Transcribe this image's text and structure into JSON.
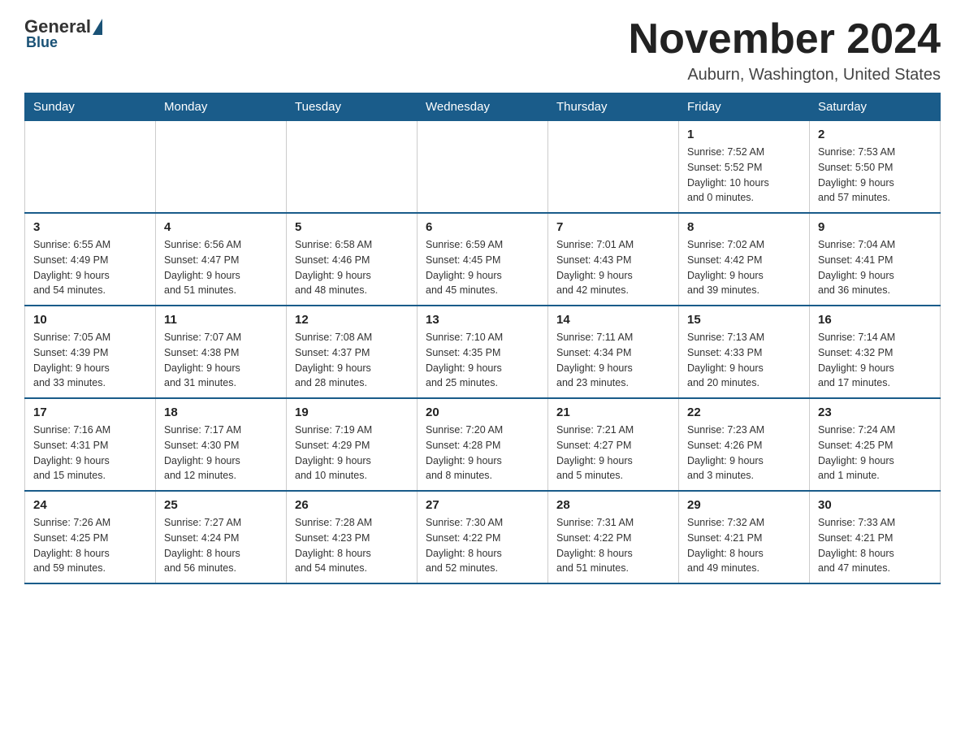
{
  "logo": {
    "general": "General",
    "blue": "Blue",
    "subtitle": "Blue"
  },
  "header": {
    "month_title": "November 2024",
    "location": "Auburn, Washington, United States"
  },
  "weekdays": [
    "Sunday",
    "Monday",
    "Tuesday",
    "Wednesday",
    "Thursday",
    "Friday",
    "Saturday"
  ],
  "weeks": [
    [
      {
        "day": "",
        "info": ""
      },
      {
        "day": "",
        "info": ""
      },
      {
        "day": "",
        "info": ""
      },
      {
        "day": "",
        "info": ""
      },
      {
        "day": "",
        "info": ""
      },
      {
        "day": "1",
        "info": "Sunrise: 7:52 AM\nSunset: 5:52 PM\nDaylight: 10 hours\nand 0 minutes."
      },
      {
        "day": "2",
        "info": "Sunrise: 7:53 AM\nSunset: 5:50 PM\nDaylight: 9 hours\nand 57 minutes."
      }
    ],
    [
      {
        "day": "3",
        "info": "Sunrise: 6:55 AM\nSunset: 4:49 PM\nDaylight: 9 hours\nand 54 minutes."
      },
      {
        "day": "4",
        "info": "Sunrise: 6:56 AM\nSunset: 4:47 PM\nDaylight: 9 hours\nand 51 minutes."
      },
      {
        "day": "5",
        "info": "Sunrise: 6:58 AM\nSunset: 4:46 PM\nDaylight: 9 hours\nand 48 minutes."
      },
      {
        "day": "6",
        "info": "Sunrise: 6:59 AM\nSunset: 4:45 PM\nDaylight: 9 hours\nand 45 minutes."
      },
      {
        "day": "7",
        "info": "Sunrise: 7:01 AM\nSunset: 4:43 PM\nDaylight: 9 hours\nand 42 minutes."
      },
      {
        "day": "8",
        "info": "Sunrise: 7:02 AM\nSunset: 4:42 PM\nDaylight: 9 hours\nand 39 minutes."
      },
      {
        "day": "9",
        "info": "Sunrise: 7:04 AM\nSunset: 4:41 PM\nDaylight: 9 hours\nand 36 minutes."
      }
    ],
    [
      {
        "day": "10",
        "info": "Sunrise: 7:05 AM\nSunset: 4:39 PM\nDaylight: 9 hours\nand 33 minutes."
      },
      {
        "day": "11",
        "info": "Sunrise: 7:07 AM\nSunset: 4:38 PM\nDaylight: 9 hours\nand 31 minutes."
      },
      {
        "day": "12",
        "info": "Sunrise: 7:08 AM\nSunset: 4:37 PM\nDaylight: 9 hours\nand 28 minutes."
      },
      {
        "day": "13",
        "info": "Sunrise: 7:10 AM\nSunset: 4:35 PM\nDaylight: 9 hours\nand 25 minutes."
      },
      {
        "day": "14",
        "info": "Sunrise: 7:11 AM\nSunset: 4:34 PM\nDaylight: 9 hours\nand 23 minutes."
      },
      {
        "day": "15",
        "info": "Sunrise: 7:13 AM\nSunset: 4:33 PM\nDaylight: 9 hours\nand 20 minutes."
      },
      {
        "day": "16",
        "info": "Sunrise: 7:14 AM\nSunset: 4:32 PM\nDaylight: 9 hours\nand 17 minutes."
      }
    ],
    [
      {
        "day": "17",
        "info": "Sunrise: 7:16 AM\nSunset: 4:31 PM\nDaylight: 9 hours\nand 15 minutes."
      },
      {
        "day": "18",
        "info": "Sunrise: 7:17 AM\nSunset: 4:30 PM\nDaylight: 9 hours\nand 12 minutes."
      },
      {
        "day": "19",
        "info": "Sunrise: 7:19 AM\nSunset: 4:29 PM\nDaylight: 9 hours\nand 10 minutes."
      },
      {
        "day": "20",
        "info": "Sunrise: 7:20 AM\nSunset: 4:28 PM\nDaylight: 9 hours\nand 8 minutes."
      },
      {
        "day": "21",
        "info": "Sunrise: 7:21 AM\nSunset: 4:27 PM\nDaylight: 9 hours\nand 5 minutes."
      },
      {
        "day": "22",
        "info": "Sunrise: 7:23 AM\nSunset: 4:26 PM\nDaylight: 9 hours\nand 3 minutes."
      },
      {
        "day": "23",
        "info": "Sunrise: 7:24 AM\nSunset: 4:25 PM\nDaylight: 9 hours\nand 1 minute."
      }
    ],
    [
      {
        "day": "24",
        "info": "Sunrise: 7:26 AM\nSunset: 4:25 PM\nDaylight: 8 hours\nand 59 minutes."
      },
      {
        "day": "25",
        "info": "Sunrise: 7:27 AM\nSunset: 4:24 PM\nDaylight: 8 hours\nand 56 minutes."
      },
      {
        "day": "26",
        "info": "Sunrise: 7:28 AM\nSunset: 4:23 PM\nDaylight: 8 hours\nand 54 minutes."
      },
      {
        "day": "27",
        "info": "Sunrise: 7:30 AM\nSunset: 4:22 PM\nDaylight: 8 hours\nand 52 minutes."
      },
      {
        "day": "28",
        "info": "Sunrise: 7:31 AM\nSunset: 4:22 PM\nDaylight: 8 hours\nand 51 minutes."
      },
      {
        "day": "29",
        "info": "Sunrise: 7:32 AM\nSunset: 4:21 PM\nDaylight: 8 hours\nand 49 minutes."
      },
      {
        "day": "30",
        "info": "Sunrise: 7:33 AM\nSunset: 4:21 PM\nDaylight: 8 hours\nand 47 minutes."
      }
    ]
  ]
}
